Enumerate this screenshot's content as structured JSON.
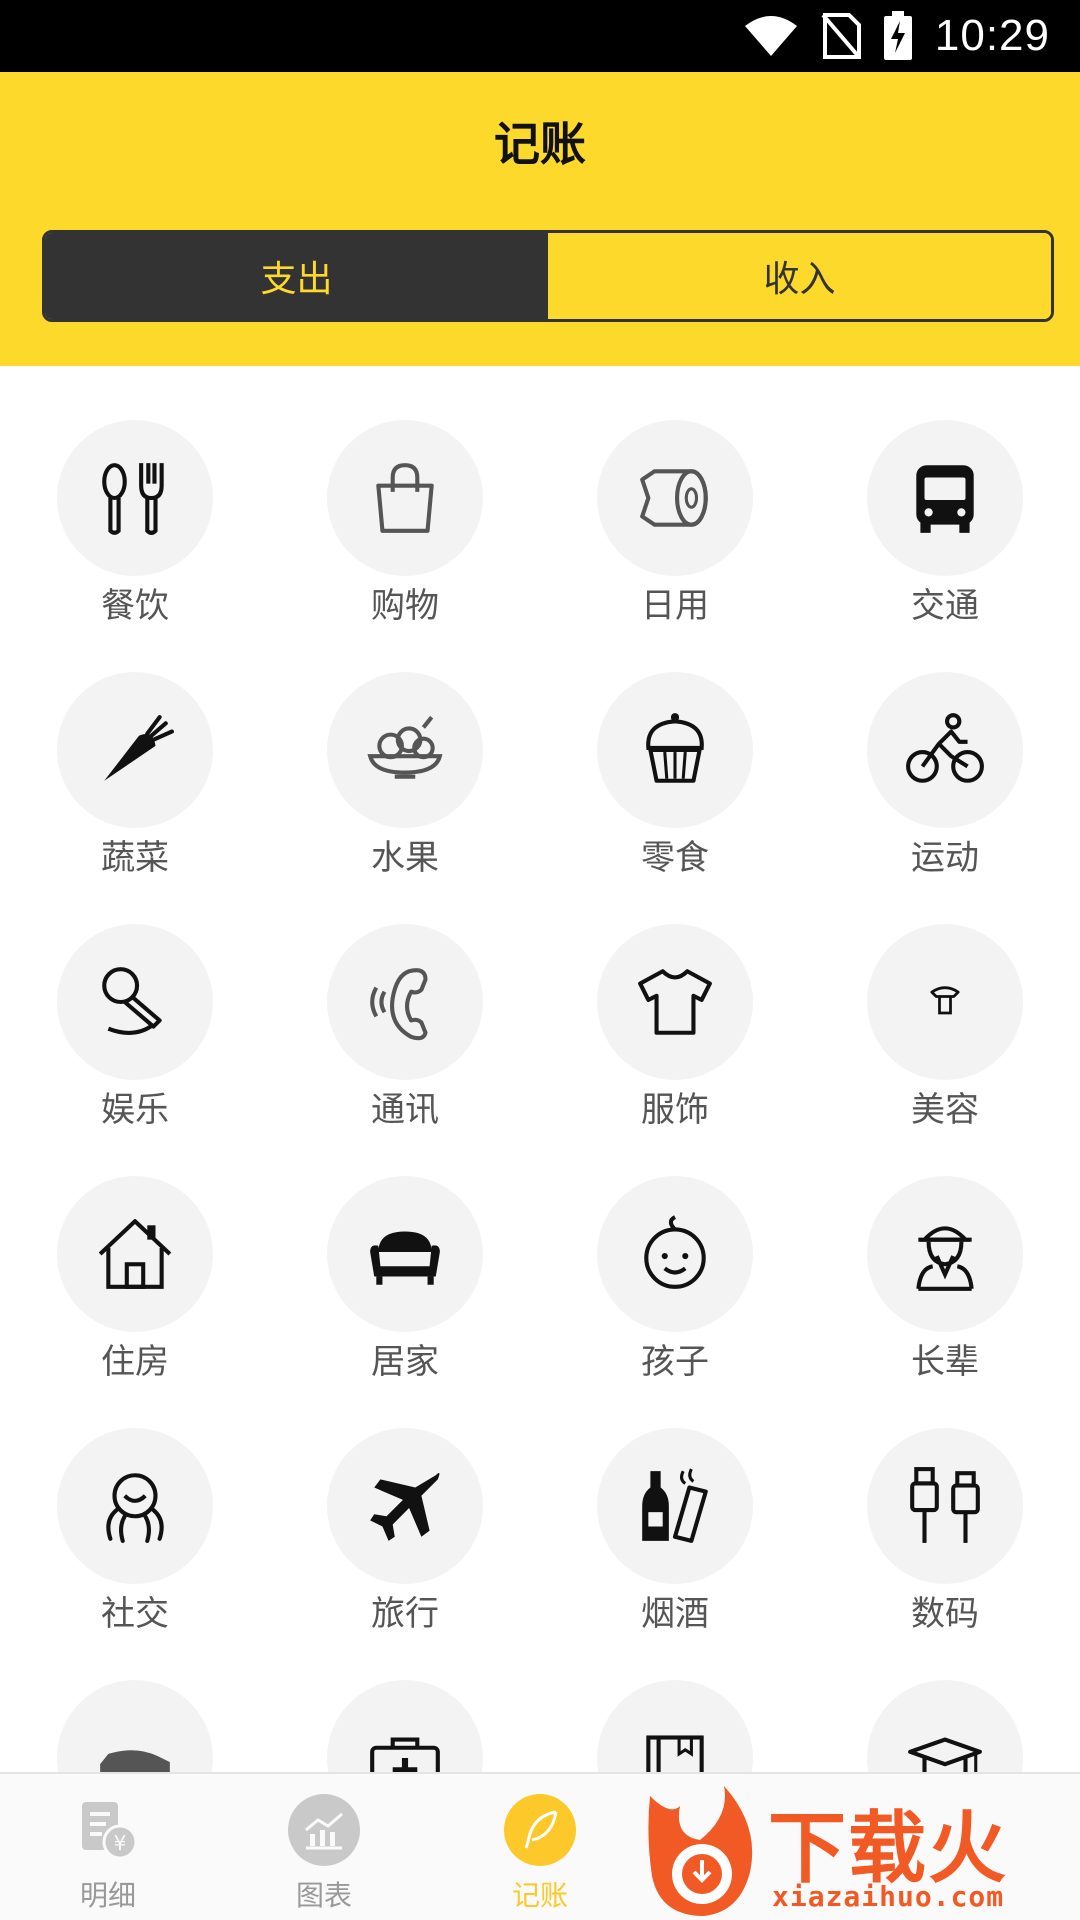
{
  "status_bar": {
    "time": "10:29"
  },
  "header": {
    "title": "记账"
  },
  "segment": {
    "expense": "支出",
    "income": "收入"
  },
  "categories": [
    "餐饮",
    "购物",
    "日用",
    "交通",
    "蔬菜",
    "水果",
    "零食",
    "运动",
    "娱乐",
    "通讯",
    "服饰",
    "美容",
    "住房",
    "居家",
    "孩子",
    "长辈",
    "社交",
    "旅行",
    "烟酒",
    "数码"
  ],
  "bottom_nav": {
    "details": "明细",
    "charts": "图表",
    "record": "记账"
  },
  "watermark": {
    "text": "下载火",
    "url": "xiazaihuo.com"
  },
  "colors": {
    "accent": "#fdd92c",
    "dark": "#333333",
    "icon_bg": "#f3f3f3",
    "watermark": "#f15a24"
  }
}
